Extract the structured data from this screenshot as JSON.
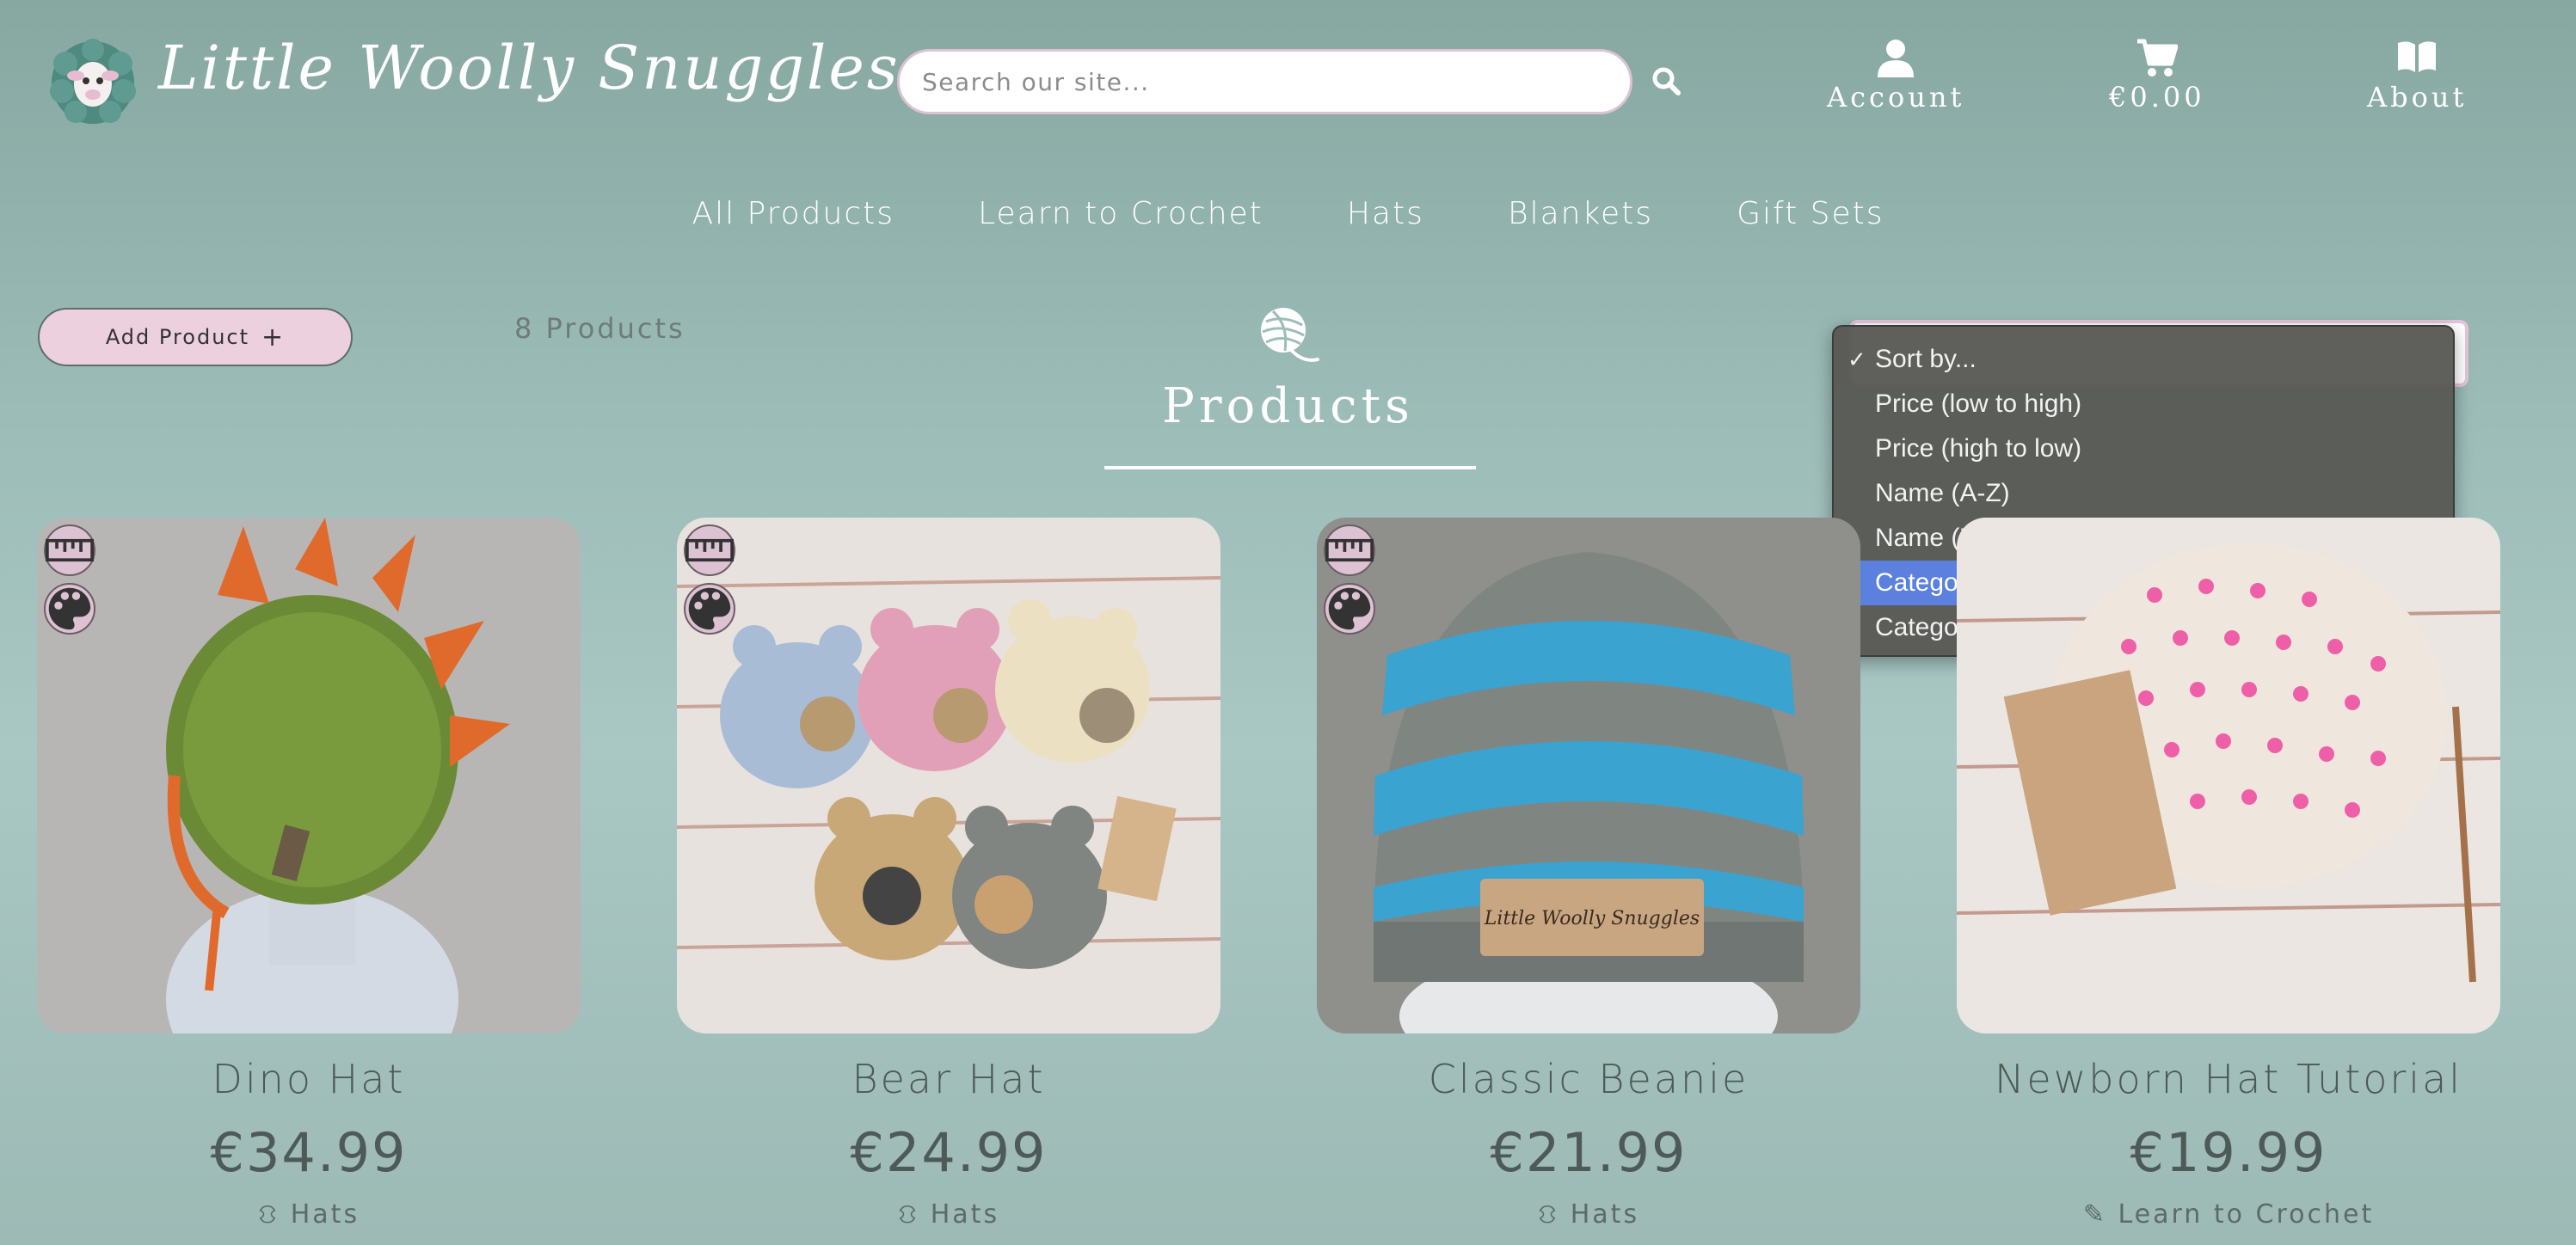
{
  "header": {
    "site_title": "Little Woolly Snuggles",
    "search_placeholder": "Search our site...",
    "account_label": "Account",
    "cart_label": "€0.00",
    "about_label": "About"
  },
  "nav": {
    "items": [
      "All Products",
      "Learn to Crochet",
      "Hats",
      "Blankets",
      "Gift Sets"
    ]
  },
  "toolbar": {
    "add_product_label": "Add Product",
    "product_count": "8 Products",
    "heading": "Products"
  },
  "sort": {
    "options": [
      {
        "label": "Sort by...",
        "checked": true
      },
      {
        "label": "Price (low to high)"
      },
      {
        "label": "Price (high to low)"
      },
      {
        "label": "Name (A-Z)"
      },
      {
        "label": "Name (Z-A)"
      },
      {
        "label": "Category (A-Z)",
        "highlighted": true
      },
      {
        "label": "Category (Z-A)"
      }
    ],
    "highlight_color": "#5b80dd"
  },
  "products": [
    {
      "name": "Dino Hat",
      "price": "€34.99",
      "category": "Hats",
      "category_icon": "hat-icon"
    },
    {
      "name": "Bear Hat",
      "price": "€24.99",
      "category": "Hats",
      "category_icon": "hat-icon"
    },
    {
      "name": "Classic Beanie",
      "price": "€21.99",
      "category": "Hats",
      "category_icon": "hat-icon"
    },
    {
      "name": "Newborn Hat Tutorial",
      "price": "€19.99",
      "category": "Learn to Crochet",
      "category_icon": "gift-tag-icon"
    }
  ],
  "product_image_labels": {
    "beanie_tag": "Little Woolly Snuggles"
  },
  "colors": {
    "background": "#9dbdb8",
    "badge": "#dcc2d2",
    "text_dark": "#4d5a57"
  }
}
